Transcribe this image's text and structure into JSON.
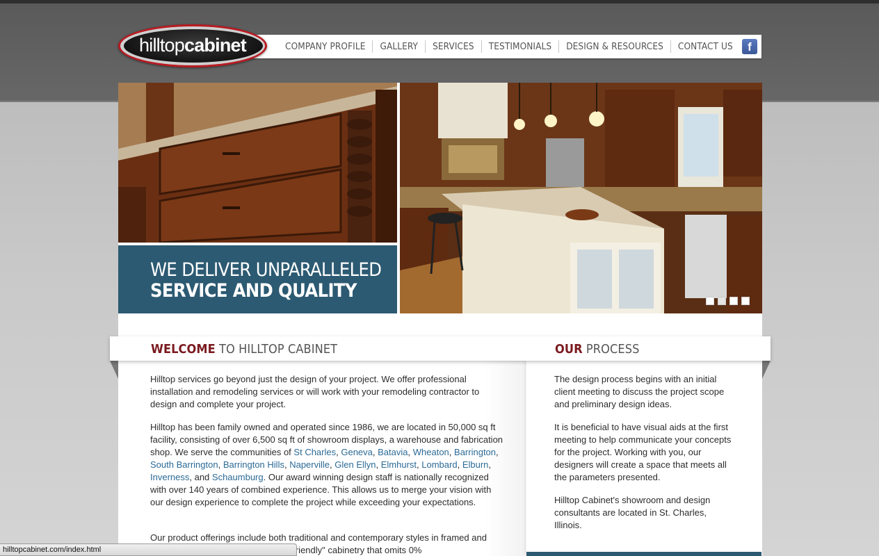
{
  "logo": {
    "text_light": "hilltop",
    "text_bold": "cabinet"
  },
  "nav": {
    "items": [
      {
        "label": "COMPANY PROFILE"
      },
      {
        "label": "GALLERY"
      },
      {
        "label": "SERVICES"
      },
      {
        "label": "TESTIMONIALS"
      },
      {
        "label": "DESIGN & RESOURCES"
      },
      {
        "label": "CONTACT US"
      }
    ],
    "facebook_icon": "facebook-icon",
    "facebook_glyph": "f"
  },
  "hero": {
    "caption_line1": "WE DELIVER UNPARALLELED",
    "caption_line2": "SERVICE AND QUALITY",
    "slide_count": 4,
    "active_slide": 1
  },
  "welcome": {
    "heading_accent": "WELCOME",
    "heading_rest": " TO HILLTOP CABINET",
    "p1": "Hilltop services go beyond just the design of your project. We offer professional installation and remodeling services or will work with your remodeling contractor to design and complete your project.",
    "p2_pre": "Hilltop has been family owned and operated since 1986, we are located in 50,000 sq ft facility, consisting of over 6,500 sq ft of showroom displays, a warehouse and fabrication shop. We serve the communities of ",
    "communities": [
      "St Charles",
      "Geneva",
      "Batavia",
      "Wheaton",
      "Barrington",
      "South Barrington",
      "Barrington Hills",
      "Naperville",
      "Glen Ellyn",
      "Elmhurst",
      "Lombard",
      "Elburn",
      "Inverness",
      "Schaumburg"
    ],
    "p2_post": ". Our award winning design staff is nationally recognized with over 140 years of combined experience. This allows us to merge your vision with our design experience to complete the project while exceeding your expectations.",
    "p3": "Our product offerings include both traditional and contemporary styles in framed and frameless cabinetry, including \"EcoFriendly\" cabinetry that omits 0%"
  },
  "process": {
    "heading_accent": "OUR",
    "heading_rest": " PROCESS",
    "p1": "The design process begins with an initial client meeting to discuss the project scope and preliminary design ideas.",
    "p2": "It is beneficial to have visual aids at the first meeting to help communicate your concepts for the project. Working with you, our designers will create a space that meets all the parameters presented.",
    "p3": "Hilltop Cabinet's showroom and design consultants are located in St. Charles, Illinois."
  },
  "statusbar": {
    "url": "hilltopcabinet.com/index.html"
  },
  "colors": {
    "accent_red": "#7a1a1f",
    "caption_blue": "#2c5a72",
    "link_blue": "#2b6a96"
  }
}
